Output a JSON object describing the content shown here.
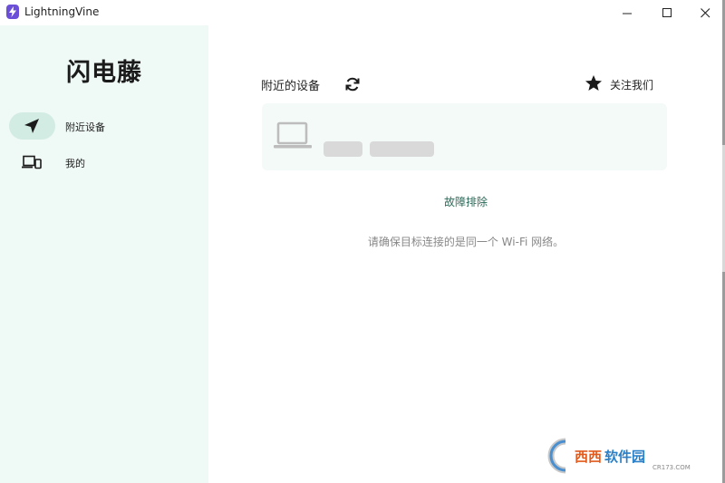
{
  "window": {
    "title": "LightningVine",
    "controls": [
      "minimize-icon",
      "maximize-icon",
      "close-icon"
    ]
  },
  "sidebar": {
    "brand": "闪电藤",
    "items": [
      {
        "label": "附近设备",
        "icon": "navigation-arrow-icon",
        "selected": true
      },
      {
        "label": "我的",
        "icon": "devices-icon",
        "selected": false
      }
    ]
  },
  "main": {
    "section_title": "附近的设备",
    "refresh_icon": "refresh-icon",
    "follow_label": "关注我们",
    "follow_icon": "star-icon",
    "device_card": {
      "icon": "laptop-icon",
      "loading": true
    },
    "troubleshoot_link": "故障排除",
    "hint": "请确保目标连接的是同一个 Wi-Fi 网络。"
  },
  "watermark": {
    "brand": "西西软件园",
    "url": "CR173.COM"
  },
  "colors": {
    "sidebar_bg": "#eff9f5",
    "nav_selected": "#d2ece4",
    "link": "#2a6a58",
    "hint": "#888888",
    "app_icon": "#6b4fd8"
  }
}
